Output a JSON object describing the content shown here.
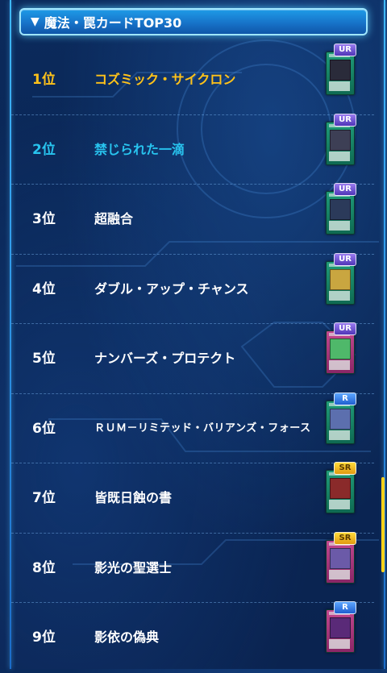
{
  "header": {
    "title": "魔法・罠カードTOP30",
    "icon": "triangle-down-icon",
    "arrow": "▼"
  },
  "rows": [
    {
      "rank": "1位",
      "name": "コズミック・サイクロン",
      "rarity": "UR",
      "card_type": "spell",
      "art_color": "#2a2b3a"
    },
    {
      "rank": "2位",
      "name": "禁じられた一滴",
      "rarity": "UR",
      "card_type": "spell",
      "art_color": "#3d3f55"
    },
    {
      "rank": "3位",
      "name": "超融合",
      "rarity": "UR",
      "card_type": "spell",
      "art_color": "#2b3a5a"
    },
    {
      "rank": "4位",
      "name": "ダブル・アップ・チャンス",
      "rarity": "UR",
      "card_type": "spell",
      "art_color": "#c9a640"
    },
    {
      "rank": "5位",
      "name": "ナンバーズ・プロテクト",
      "rarity": "UR",
      "card_type": "trap",
      "art_color": "#4fb86a"
    },
    {
      "rank": "6位",
      "name": "ＲＵＭ－リミテッド・バリアンズ・フォース",
      "rarity": "R",
      "card_type": "spell",
      "art_color": "#5c6fae"
    },
    {
      "rank": "7位",
      "name": "皆既日蝕の書",
      "rarity": "SR",
      "card_type": "spell",
      "art_color": "#8a2a2a"
    },
    {
      "rank": "8位",
      "name": "影光の聖選士",
      "rarity": "SR",
      "card_type": "trap",
      "art_color": "#6b5aa8"
    },
    {
      "rank": "9位",
      "name": "影依の偽典",
      "rarity": "R",
      "card_type": "trap",
      "art_color": "#5a2a78"
    }
  ],
  "colors": {
    "gold": "#ffc21a",
    "cyan": "#28c4ef",
    "white": "#ffffff"
  }
}
